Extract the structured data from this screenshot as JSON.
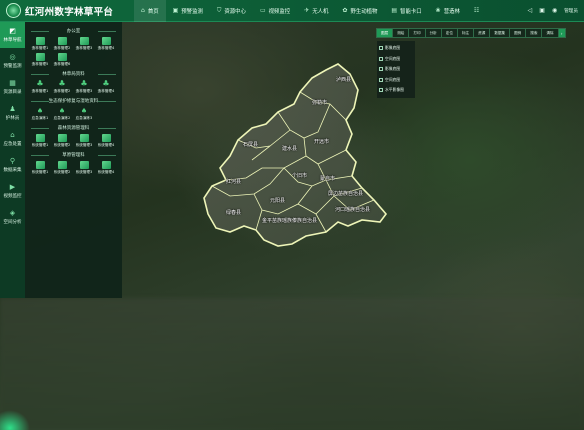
{
  "app": {
    "title": "红河州数字林草平台"
  },
  "header": {
    "nav": [
      {
        "label": "首页",
        "icon": "home-icon",
        "glyph": "⌂"
      },
      {
        "label": "预警监测",
        "icon": "alert-monitor-icon",
        "glyph": "▣"
      },
      {
        "label": "资源中心",
        "icon": "shield-icon",
        "glyph": "⛉"
      },
      {
        "label": "视频监控",
        "icon": "video-chat-icon",
        "glyph": "▭"
      },
      {
        "label": "无人机",
        "icon": "drone-icon",
        "glyph": "✈"
      },
      {
        "label": "野生动植物",
        "icon": "wildlife-icon",
        "glyph": "✿"
      },
      {
        "label": "智能卡口",
        "icon": "checkpoint-icon",
        "glyph": "▤"
      },
      {
        "label": "营造林",
        "icon": "forest-icon",
        "glyph": "❀"
      },
      {
        "label": "",
        "icon": "more-icon",
        "glyph": "☷"
      }
    ],
    "right": {
      "sound_glyph": "◁",
      "screen_glyph": "▣",
      "user_glyph": "◉",
      "user_name": "管理员"
    }
  },
  "rail": [
    {
      "label": "林草导航",
      "icon": "navigation-icon",
      "glyph": "◩"
    },
    {
      "label": "预警监测",
      "icon": "alert-icon",
      "glyph": "◎"
    },
    {
      "label": "资源目录",
      "icon": "catalog-icon",
      "glyph": "▦"
    },
    {
      "label": "护林员",
      "icon": "ranger-icon",
      "glyph": "♟"
    },
    {
      "label": "应急处置",
      "icon": "emergency-icon",
      "glyph": "⌂"
    },
    {
      "label": "数据采集",
      "icon": "data-collect-icon",
      "glyph": "⚲"
    },
    {
      "label": "视频监控",
      "icon": "video-icon",
      "glyph": "▶"
    },
    {
      "label": "空间分析",
      "icon": "spatial-analysis-icon",
      "glyph": "◈"
    }
  ],
  "panel": {
    "sections": [
      {
        "title": "办公室",
        "kind": "box",
        "items": [
          "造林管理1",
          "造林管理2",
          "造林管理3",
          "造林管理4",
          "造林管理5",
          "造林管理6"
        ]
      },
      {
        "title": "林草局资料",
        "kind": "tree",
        "items": [
          "造林管理1",
          "造林管理2",
          "造林管理3",
          "造林管理4"
        ]
      },
      {
        "title": "生态保护修复与湿地资料",
        "kind": "bird",
        "items": [
          "应急演练1",
          "应急演练2",
          "应急演练3"
        ]
      },
      {
        "title": "森林资源管理科",
        "kind": "box",
        "items": [
          "系统管理1",
          "系统管理2",
          "系统管理3",
          "系统管理4"
        ]
      },
      {
        "title": "草原管理科",
        "kind": "box",
        "items": [
          "系统管理1",
          "系统管理2",
          "系统管理3",
          "系统管理4"
        ]
      }
    ]
  },
  "map": {
    "counties": [
      "泸西县",
      "弥勒市",
      "开远市",
      "石屏县",
      "建水县",
      "个旧市",
      "蒙自市",
      "屏边苗族自治县",
      "红河县",
      "元阳县",
      "河口瑶族自治县",
      "绿春县",
      "金平苗族瑶族傣族自治县"
    ]
  },
  "layers": {
    "tabs": [
      "图层",
      "测绘",
      "打印",
      "分析",
      "定位",
      "标注",
      "资源",
      "数据集",
      "图例",
      "搜索",
      "清除"
    ],
    "menu": [
      "影像底图",
      "空间底图",
      "影像底图",
      "空间底图",
      "水平影像图"
    ]
  },
  "colors": {
    "brand": "#0f6b3d",
    "accent": "#1f9a57",
    "boundary": "#e8f2b0"
  }
}
